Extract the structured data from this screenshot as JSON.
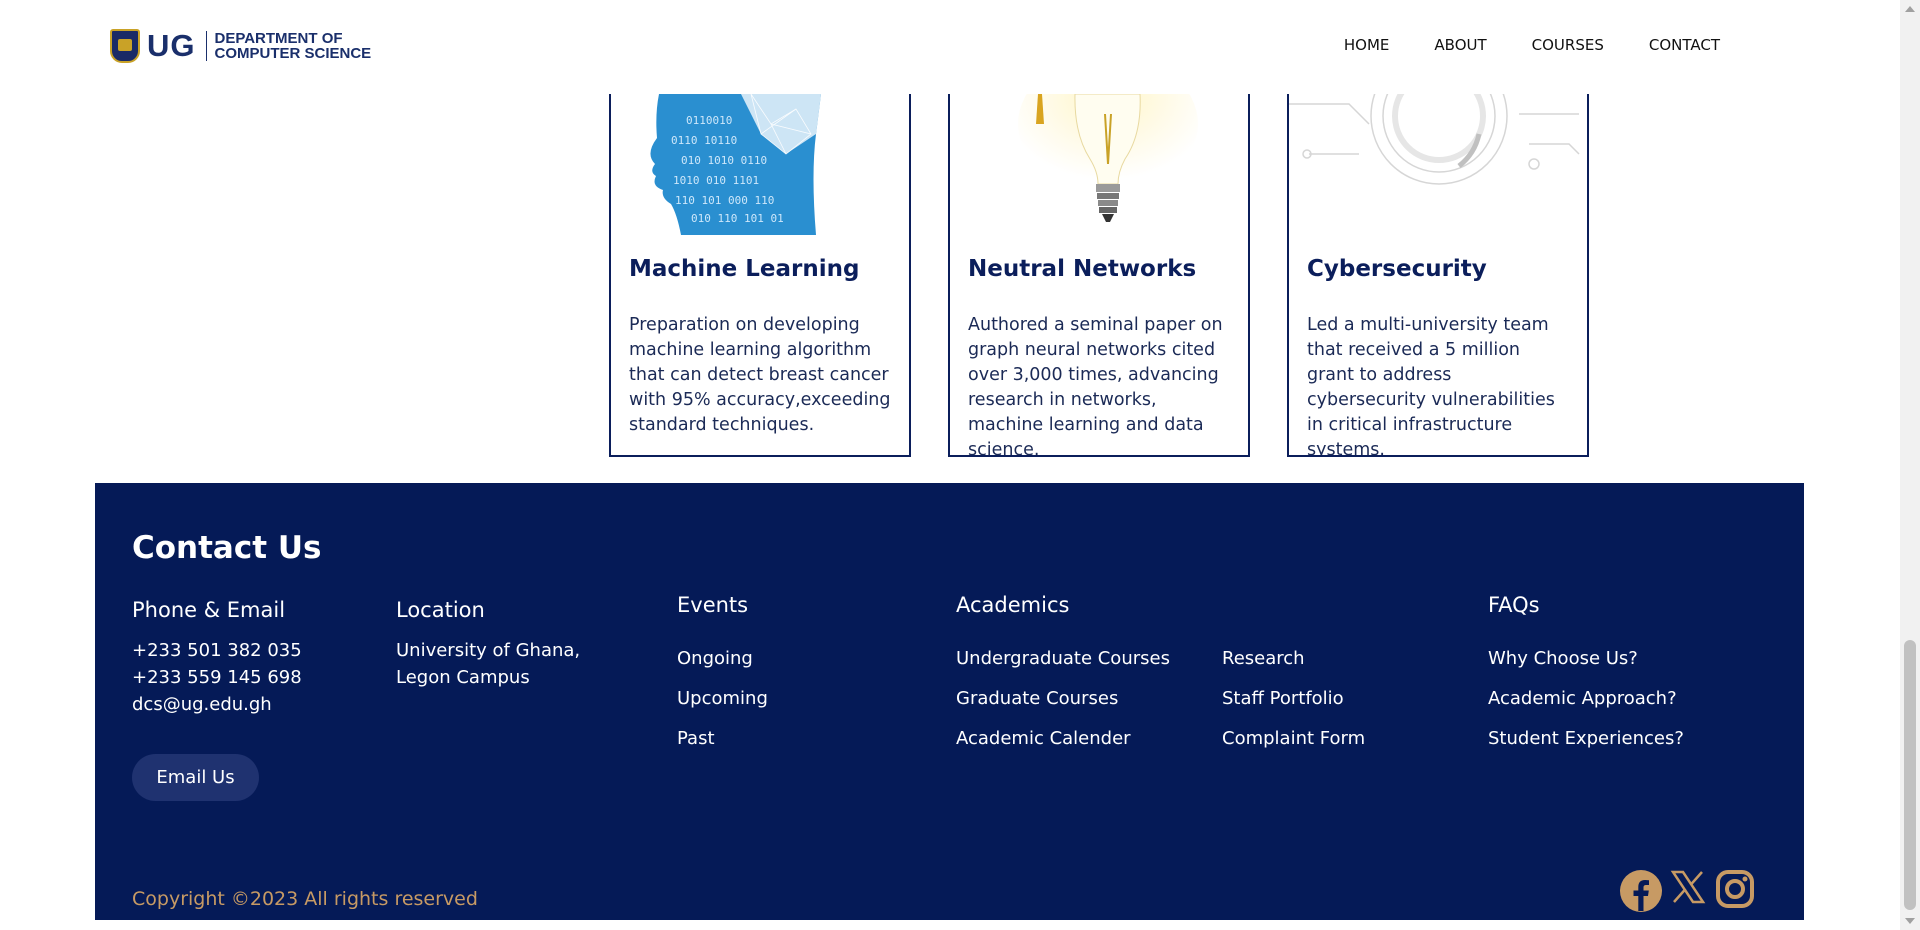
{
  "header": {
    "logo_text": "UG",
    "dept_line1": "DEPARTMENT OF",
    "dept_line2": "COMPUTER SCIENCE",
    "nav": [
      "HOME",
      "ABOUT",
      "COURSES",
      "CONTACT"
    ]
  },
  "cards": [
    {
      "title": "Machine Learning",
      "body": "Preparation on developing machine learning algorithm that can detect breast cancer with 95% accuracy,exceeding standard techniques.",
      "image": "binary-head-image"
    },
    {
      "title": "Neutral Networks",
      "body": "Authored a seminal paper on graph neural networks cited over 3,000 times, advancing research in networks, machine learning and data science.",
      "image": "lightbulb-image"
    },
    {
      "title": "Cybersecurity",
      "body": "Led a multi-university team that received a 5 million grant to address cybersecurity vulnerabilities in critical infrastructure systems.",
      "image": "circuit-ring-image"
    }
  ],
  "footer": {
    "title": "Contact Us",
    "phone_heading": "Phone & Email",
    "phone1": "+233 501 382 035",
    "phone2": "+233 559 145 698",
    "email": "dcs@ug.edu.gh",
    "location_heading": "Location",
    "location_line1": "University of Ghana,",
    "location_line2": "Legon Campus",
    "events_heading": "Events",
    "events": [
      "Ongoing",
      "Upcoming",
      "Past"
    ],
    "academics_heading": "Academics",
    "academics_col1": [
      "Undergraduate Courses",
      "Graduate Courses",
      "Academic Calender"
    ],
    "academics_col2": [
      "Research",
      "Staff Portfolio",
      "Complaint Form"
    ],
    "faqs_heading": "FAQs",
    "faqs": [
      "Why Choose Us?",
      "Academic Approach?",
      "Student Experiences?"
    ],
    "email_button": "Email Us",
    "copyright": "Copyright ©2023 All rights reserved",
    "social_icons": [
      "facebook-icon",
      "x-icon",
      "instagram-icon"
    ],
    "colors": {
      "background": "#051a57",
      "copyright": "#c79a64",
      "social": "#c79a64"
    }
  }
}
